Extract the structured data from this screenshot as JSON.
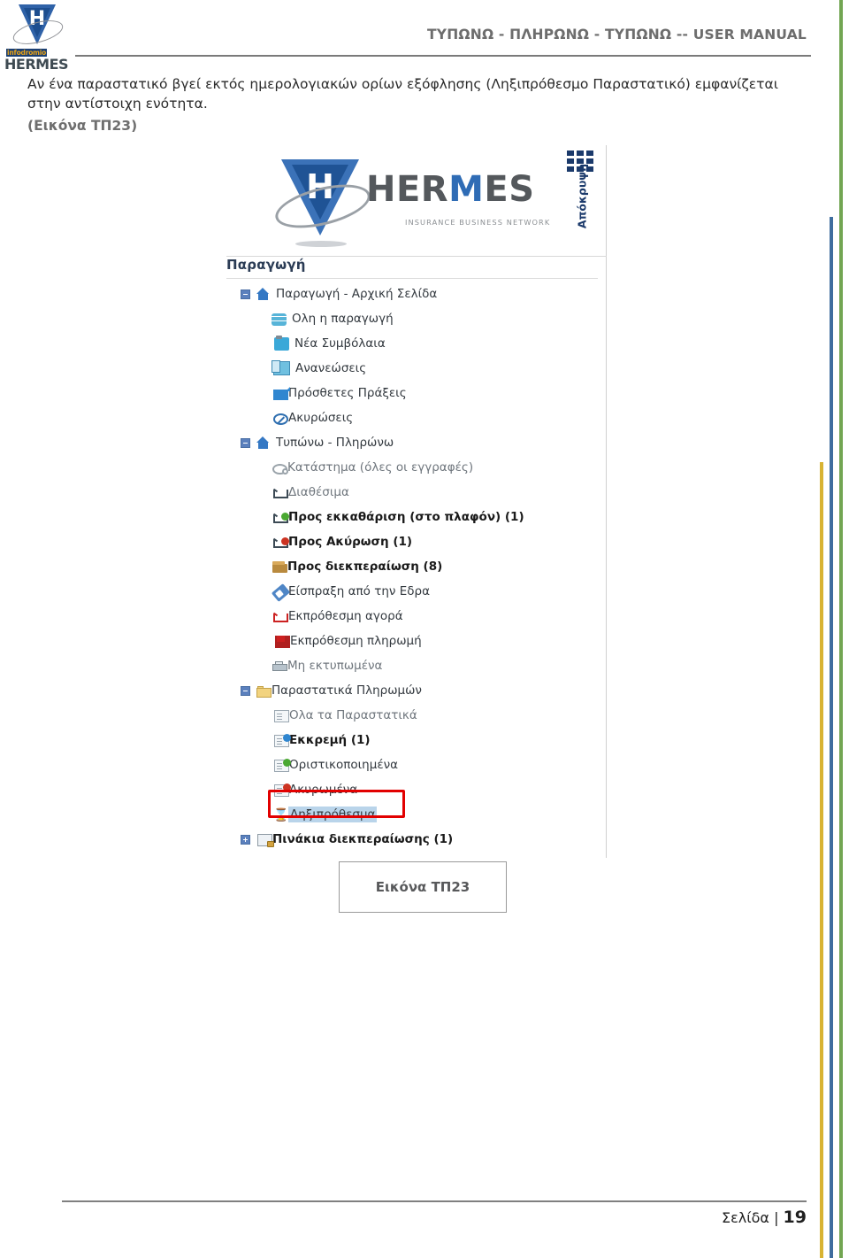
{
  "header": {
    "title": "ΤΥΠΩΝΩ - ΠΛΗΡΩΝΩ - ΤΥΠΩΝΩ -- USER MANUAL",
    "logo": {
      "letter": "H",
      "brand_top": "infodromio",
      "brand_bottom": "HERMES"
    }
  },
  "body": {
    "paragraph": "Αν ένα παραστατικό βγεί εκτός ημερολογιακών ορίων εξόφλησης (Ληξιπρόθεσμο Παραστατικό) εμφανίζεται στην αντίστοιχη ενότητα.",
    "figure_reference": "(Εικόνα ΤΠ23)"
  },
  "screenshot": {
    "banner": {
      "shield_letter": "H",
      "wordmark_a": "HER",
      "wordmark_m": "M",
      "wordmark_b": "ES",
      "tagline": "INSURANCE BUSINESS NETWORK"
    },
    "hide_panel": {
      "label": "Απόκρυψη",
      "icon": "grid-icon"
    },
    "tree_title": "Παραγωγή",
    "tree": [
      {
        "label": "Παραγωγή - Αρχική Σελίδα",
        "level": 0,
        "toggle": "minus",
        "icon": "home-icon",
        "bold": false,
        "muted": false
      },
      {
        "label": "Ολη η παραγωγή",
        "level": 1,
        "toggle": "none",
        "icon": "database-icon",
        "bold": false,
        "muted": false
      },
      {
        "label": "Νέα Συμβόλαια",
        "level": 1,
        "toggle": "none",
        "icon": "clipboard-icon",
        "bold": false,
        "muted": false
      },
      {
        "label": "Ανανεώσεις",
        "level": 1,
        "toggle": "none",
        "icon": "copy-icon",
        "bold": false,
        "muted": false
      },
      {
        "label": "Πρόσθετες Πράξεις",
        "level": 1,
        "toggle": "none",
        "icon": "square-page-icon",
        "bold": false,
        "muted": false
      },
      {
        "label": "Ακυρώσεις",
        "level": 1,
        "toggle": "none",
        "icon": "ban-icon",
        "bold": false,
        "muted": false
      },
      {
        "label": "Τυπώνω - Πληρώνω",
        "level": 0,
        "toggle": "minus",
        "icon": "home-icon",
        "bold": false,
        "muted": false
      },
      {
        "label": "Κατάστημα (όλες οι εγγραφές)",
        "level": 1,
        "toggle": "none",
        "icon": "gear-icon",
        "bold": false,
        "muted": true
      },
      {
        "label": "Διαθέσιμα",
        "level": 1,
        "toggle": "none",
        "icon": "cart-icon",
        "bold": false,
        "muted": true
      },
      {
        "label": "Προς εκκαθάριση (στο πλαφόν) (1)",
        "level": 1,
        "toggle": "none",
        "icon": "cart-check-icon",
        "bold": true,
        "muted": false
      },
      {
        "label": "Προς Ακύρωση (1)",
        "level": 1,
        "toggle": "none",
        "icon": "cart-cancel-icon",
        "bold": true,
        "muted": false
      },
      {
        "label": "Προς διεκπεραίωση (8)",
        "level": 1,
        "toggle": "none",
        "icon": "box-icon",
        "bold": true,
        "muted": false
      },
      {
        "label": "Είσπραξη από την Εδρα",
        "level": 1,
        "toggle": "none",
        "icon": "paperclip-icon",
        "bold": false,
        "muted": false
      },
      {
        "label": "Εκπρόθεσμη αγορά",
        "level": 1,
        "toggle": "none",
        "icon": "cart-red-icon",
        "bold": false,
        "muted": false
      },
      {
        "label": "Εκπρόθεσμη πληρωμή",
        "level": 1,
        "toggle": "none",
        "icon": "flag-icon",
        "bold": false,
        "muted": false
      },
      {
        "label": "Μη εκτυπωμένα",
        "level": 1,
        "toggle": "none",
        "icon": "printer-icon",
        "bold": false,
        "muted": true
      },
      {
        "label": "Παραστατικά Πληρωμών",
        "level": 0,
        "toggle": "minus",
        "icon": "folder-icon",
        "bold": false,
        "muted": false
      },
      {
        "label": "Ολα τα Παραστατικά",
        "level": 1,
        "toggle": "none",
        "icon": "document-icon",
        "bold": false,
        "muted": true
      },
      {
        "label": "Εκκρεμή (1)",
        "level": 1,
        "toggle": "none",
        "icon": "document-pending-icon",
        "bold": true,
        "muted": false
      },
      {
        "label": "Οριστικοποιημένα",
        "level": 1,
        "toggle": "none",
        "icon": "document-approved-icon",
        "bold": false,
        "muted": false
      },
      {
        "label": "Ακυρωμένα",
        "level": 1,
        "toggle": "none",
        "icon": "document-cancelled-icon",
        "bold": false,
        "muted": false
      },
      {
        "label": "Ληξιπρόθεσμα",
        "level": 1,
        "toggle": "none",
        "icon": "hourglass-icon",
        "bold": false,
        "muted": false,
        "selected": true,
        "highlighted": true
      },
      {
        "label": "Πινάκια διεκπεραίωσης (1)",
        "level": 0,
        "toggle": "plus",
        "icon": "locked-document-icon",
        "bold": true,
        "muted": false
      }
    ]
  },
  "figure": {
    "caption": "Εικόνα ΤΠ23"
  },
  "footer": {
    "page_label": "Σελίδα |",
    "page_number": "19"
  },
  "colors": {
    "header_text": "#6d6d6d",
    "highlight_box": "#e20000",
    "selection": "#b9d4ea",
    "bar_green": "#72a552",
    "bar_blue": "#3f6d9e",
    "bar_yellow": "#d8b333"
  }
}
